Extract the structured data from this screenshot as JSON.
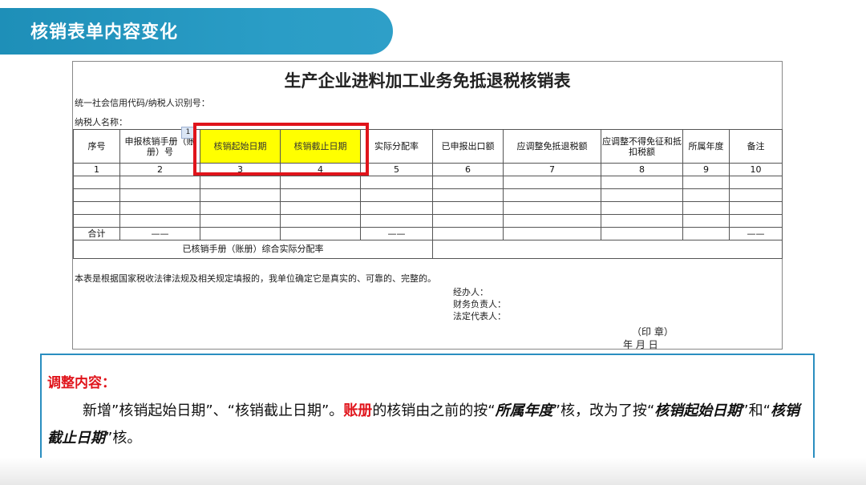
{
  "header": {
    "title": "核销表单内容变化"
  },
  "form": {
    "title": "生产企业进料加工业务免抵退税核销表",
    "meta_tax_id": "统一社会信用代码/纳税人识别号：",
    "meta_name": "纳税人名称：",
    "column_note": "1",
    "columns": [
      "序号",
      "申报核销手册（账册）号",
      "核销起始日期",
      "核销截止日期",
      "实际分配率",
      "已申报出口额",
      "应调整免抵退税额",
      "应调整不得免征和抵扣税额",
      "所属年度",
      "备注"
    ],
    "column_numbers": [
      "1",
      "2",
      "3",
      "4",
      "5",
      "6",
      "7",
      "8",
      "9",
      "10"
    ],
    "total_row": {
      "label": "合计",
      "dash": "——"
    },
    "rate_row_label": "已核销手册（账册）综合实际分配率",
    "declaration": "本表是根据国家税收法律法规及相关规定填报的，我单位确定它是真实的、可靠的、完整的。",
    "signatures": [
      "经办人：",
      "财务负责人：",
      "法定代表人："
    ],
    "seal": "（印  章）",
    "date": "年  月  日"
  },
  "note": {
    "heading": "调整内容：",
    "p1": "新增”核销起始日期”、“核销截止日期”。",
    "p2": "账册",
    "p3": "的核销由之前的按“",
    "p4": "所属年度",
    "p5": "”核，改为了按“",
    "p6": "核销起始日期",
    "p7": "”和“",
    "p8": "核销截止日期",
    "p9": "”核。"
  },
  "colors": {
    "accent": "#1e8fb8",
    "highlight": "#ffff00",
    "alert": "#e0141b"
  }
}
